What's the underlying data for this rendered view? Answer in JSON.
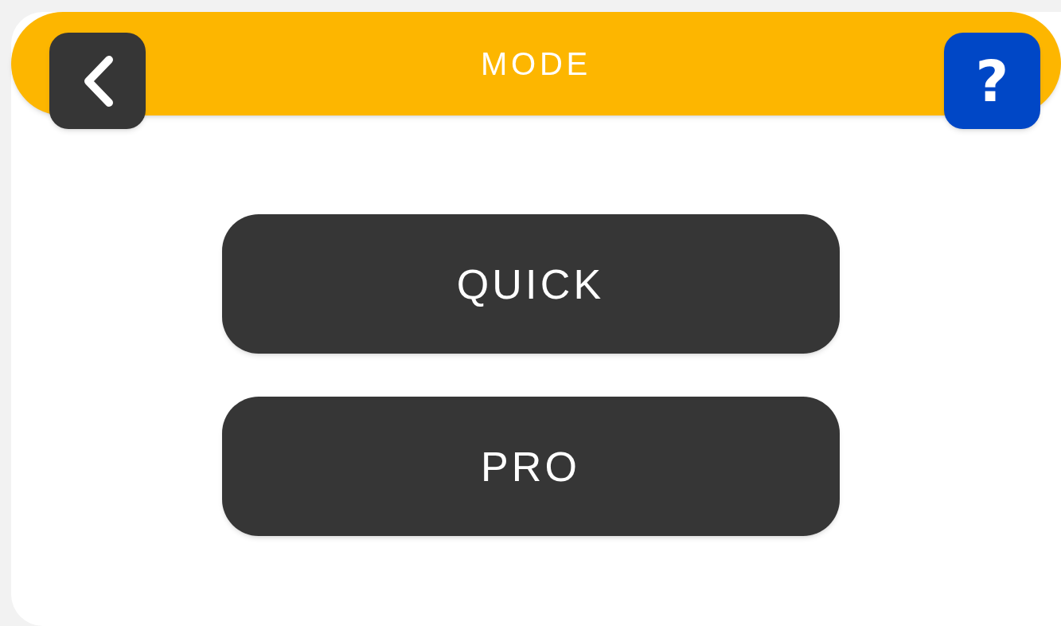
{
  "header": {
    "title": "MODE",
    "help_label": "?"
  },
  "modes": [
    {
      "label": "QUICK"
    },
    {
      "label": "PRO"
    }
  ]
}
